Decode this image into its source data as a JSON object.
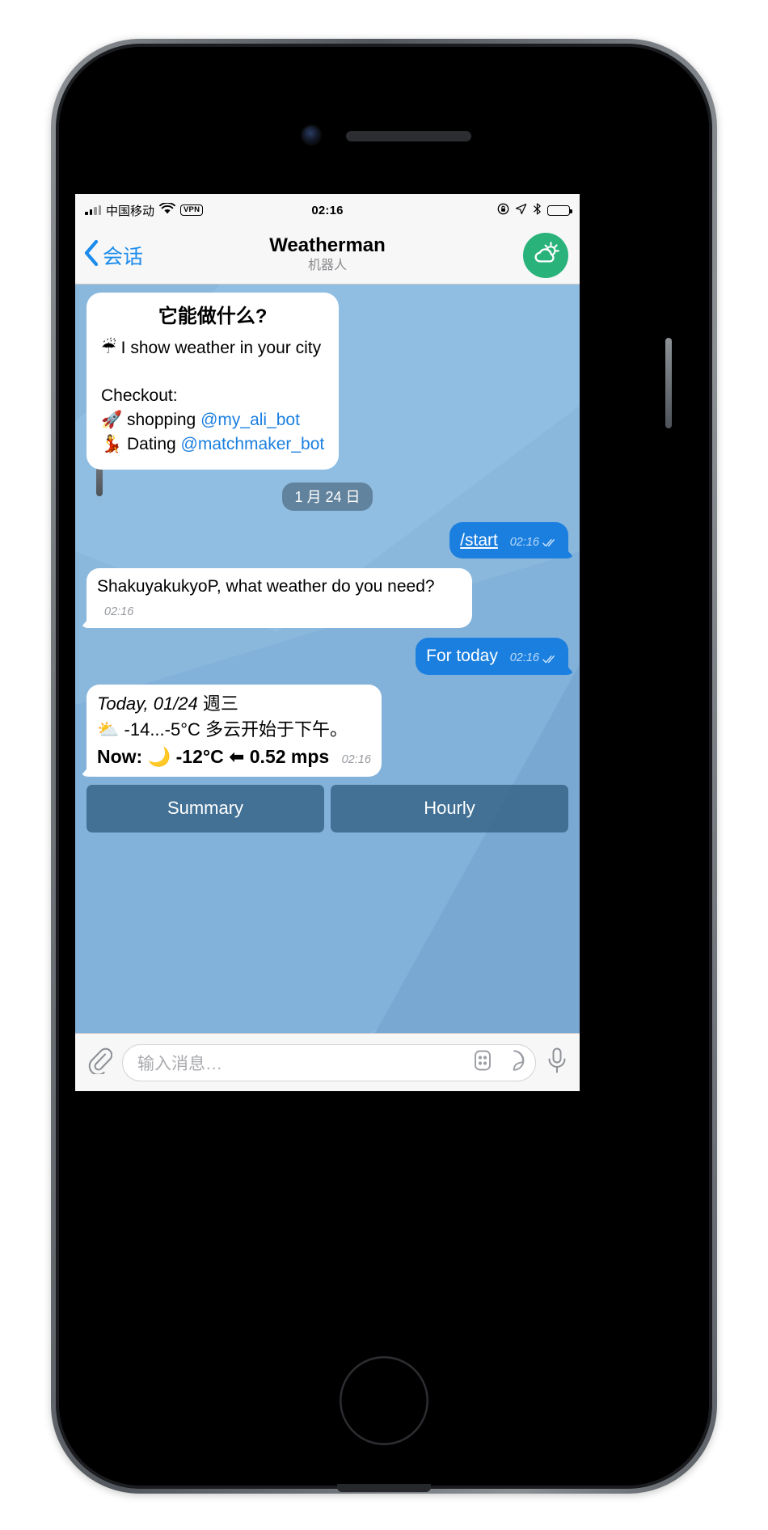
{
  "colors": {
    "accent_blue": "#1b7fe0",
    "link_blue": "#1b8cec",
    "chat_wallpaper": "#8ab8dd",
    "avatar_green": "#2ab27b",
    "keyboard_button": "#315f82",
    "bar_background": "#f7f7f7"
  },
  "status_bar": {
    "carrier": "中国移动",
    "vpn": "VPN",
    "time": "02:16",
    "icons": [
      "signal-bars-icon",
      "wifi-icon",
      "vpn-badge-icon",
      "rotation-lock-icon",
      "location-arrow-icon",
      "bluetooth-icon",
      "battery-icon"
    ]
  },
  "nav_bar": {
    "back_label": "会话",
    "back_icon": "chevron-left-icon",
    "title": "Weatherman",
    "subtitle": "机器人",
    "avatar_icon": "sun-behind-cloud-icon"
  },
  "messages": [
    {
      "id": "intro",
      "direction": "in",
      "title": "它能做什么?",
      "lines": [
        {
          "emoji": "☔",
          "emoji_name": "umbrella-with-rain-icon",
          "text": " I show weather in your city"
        },
        {
          "emoji": "",
          "emoji_name": "",
          "text": ""
        },
        {
          "emoji": "",
          "emoji_name": "",
          "text": "Checkout:"
        },
        {
          "emoji": "🚀",
          "emoji_name": "rocket-icon",
          "text": " shopping ",
          "mention": "@my_ali_bot"
        },
        {
          "emoji": "💃",
          "emoji_name": "dancer-icon",
          "text": " Dating ",
          "mention": "@matchmaker_bot"
        }
      ]
    },
    {
      "id": "start",
      "direction": "out",
      "text": "/start",
      "time": "02:16",
      "status": "read"
    },
    {
      "id": "prompt",
      "direction": "in",
      "text": "ShakuyakukyoP, what weather do you need?",
      "time": "02:16"
    },
    {
      "id": "for-today",
      "direction": "out",
      "text": "For today",
      "time": "02:16",
      "status": "read"
    }
  ],
  "date_separator": "1 月 24 日",
  "weather_message": {
    "direction": "in",
    "line1_en": "Today, 01/24 ",
    "line1_cn": "週三",
    "line2_emoji": "⛅",
    "line2_emoji_name": "sun-behind-cloud-emoji",
    "line2": " -14...-5°C 多云开始于下午。",
    "line3_label": "Now:",
    "line3_emoji": "🌙",
    "line3_emoji_name": "crescent-moon-icon",
    "line3_temp": "-12°C",
    "line3_wind_emoji": "⬅",
    "line3_wind_emoji_name": "arrow-left-icon",
    "line3_wind": "0.52 mps",
    "time": "02:16"
  },
  "inline_keyboard": [
    {
      "label": "Summary",
      "name": "summary-button"
    },
    {
      "label": "Hourly",
      "name": "hourly-button"
    }
  ],
  "input_bar": {
    "attach_icon": "paperclip-icon",
    "placeholder": "输入消息…",
    "value": "",
    "command_icon": "bot-command-icon",
    "sticker_icon": "sticker-icon",
    "mic_icon": "microphone-icon"
  }
}
